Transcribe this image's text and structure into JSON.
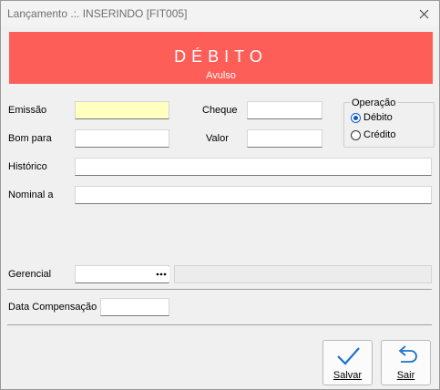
{
  "window": {
    "title": "Lançamento .:. INSERINDO [FIT005]"
  },
  "banner": {
    "title": "DÉBITO",
    "subtitle": "Avulso",
    "color": "#fd5e58"
  },
  "form": {
    "emissao": {
      "label": "Emissão",
      "value": ""
    },
    "cheque": {
      "label": "Cheque",
      "value": ""
    },
    "bom_para": {
      "label": "Bom para",
      "value": ""
    },
    "valor": {
      "label": "Valor",
      "value": ""
    },
    "historico": {
      "label": "Histórico",
      "value": ""
    },
    "nominal": {
      "label": "Nominal a",
      "value": ""
    },
    "gerencial": {
      "label": "Gerencial",
      "value": "",
      "description": ""
    },
    "data_compensacao": {
      "label": "Data Compensação",
      "value": ""
    }
  },
  "operacao": {
    "label": "Operação",
    "options": [
      {
        "label": "Débito",
        "checked": true
      },
      {
        "label": "Crédito",
        "checked": false
      }
    ]
  },
  "buttons": {
    "save_label": "Salvar",
    "exit_label": "Sair"
  },
  "icons": {
    "close": "close-icon",
    "ellipsis": "ellipsis-icon",
    "save": "checkmark-icon",
    "exit": "return-arrow-icon"
  },
  "colors": {
    "accent": "#0a5bc4",
    "highlight_field": "#ffffc0",
    "icon_blue": "#1a73c8"
  }
}
